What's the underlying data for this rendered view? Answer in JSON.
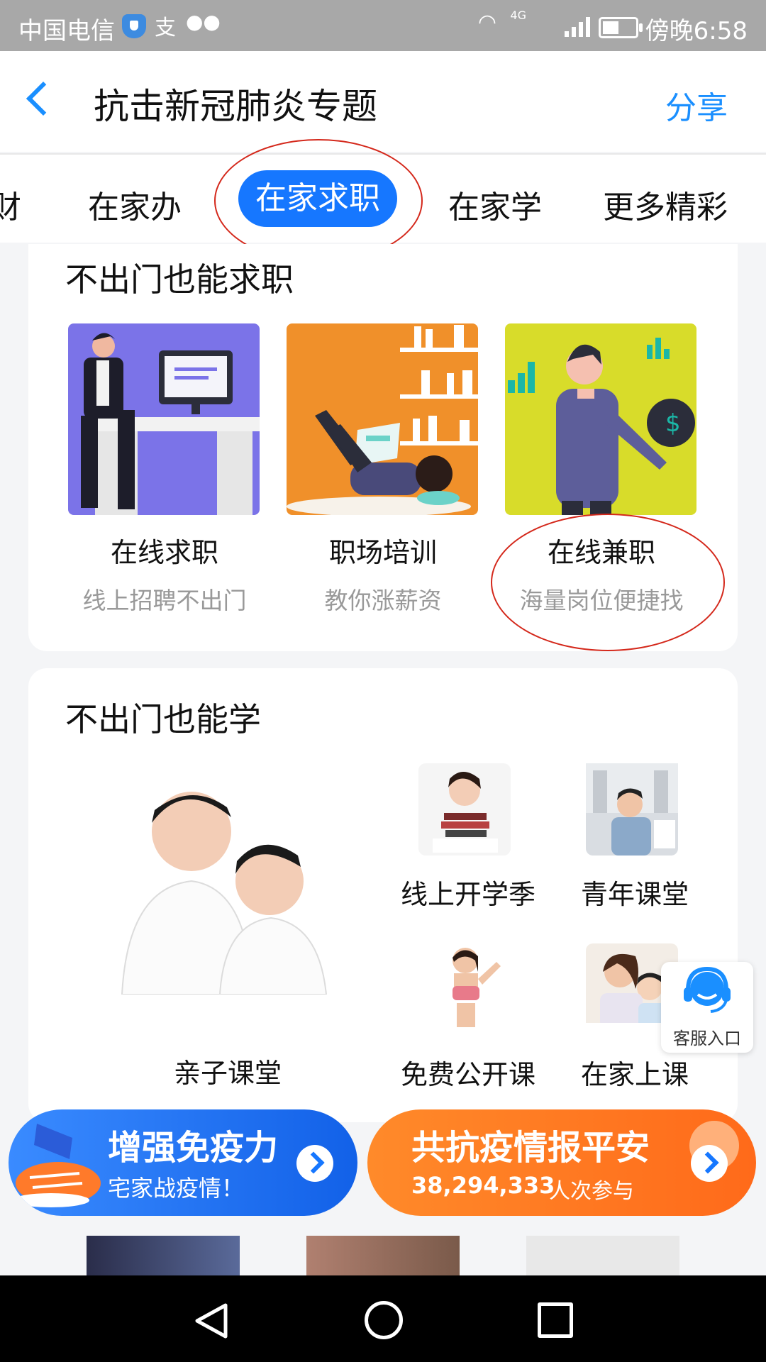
{
  "status_bar": {
    "carrier": "中国电信",
    "extra_icons": [
      "shield-icon",
      "alipay-icon",
      "wechat-icon"
    ],
    "network": "4G",
    "time": "傍晚6:58"
  },
  "header": {
    "title": "抗击新冠肺炎专题",
    "share_label": "分享"
  },
  "tabs": [
    {
      "label": "财",
      "active": false
    },
    {
      "label": "在家办",
      "active": false
    },
    {
      "label": "在家求职",
      "active": true
    },
    {
      "label": "在家学",
      "active": false
    },
    {
      "label": "更多精彩",
      "active": false
    }
  ],
  "job_section": {
    "title": "不出门也能求职",
    "items": [
      {
        "label": "在线求职",
        "sub": "线上招聘不出门"
      },
      {
        "label": "职场培训",
        "sub": "教你涨薪资"
      },
      {
        "label": "在线兼职",
        "sub": "海量岗位便捷找"
      }
    ]
  },
  "learn_section": {
    "title": "不出门也能学",
    "featured": {
      "label": "亲子课堂"
    },
    "items": [
      {
        "label": "线上开学季"
      },
      {
        "label": "青年课堂"
      },
      {
        "label": "免费公开课"
      },
      {
        "label": "在家上课"
      }
    ]
  },
  "service": {
    "label": "客服入口"
  },
  "banners": {
    "left": {
      "title": "增强免疫力",
      "sub": "宅家战疫情！"
    },
    "right": {
      "title": "共抗疫情报平安",
      "count": "38,294,333",
      "suffix": "人次参与"
    }
  },
  "colors": {
    "accent": "#1677ff",
    "highlight_ring": "#d4281b",
    "banner_left": "#1677ff",
    "banner_right": "#ff7a1a"
  }
}
